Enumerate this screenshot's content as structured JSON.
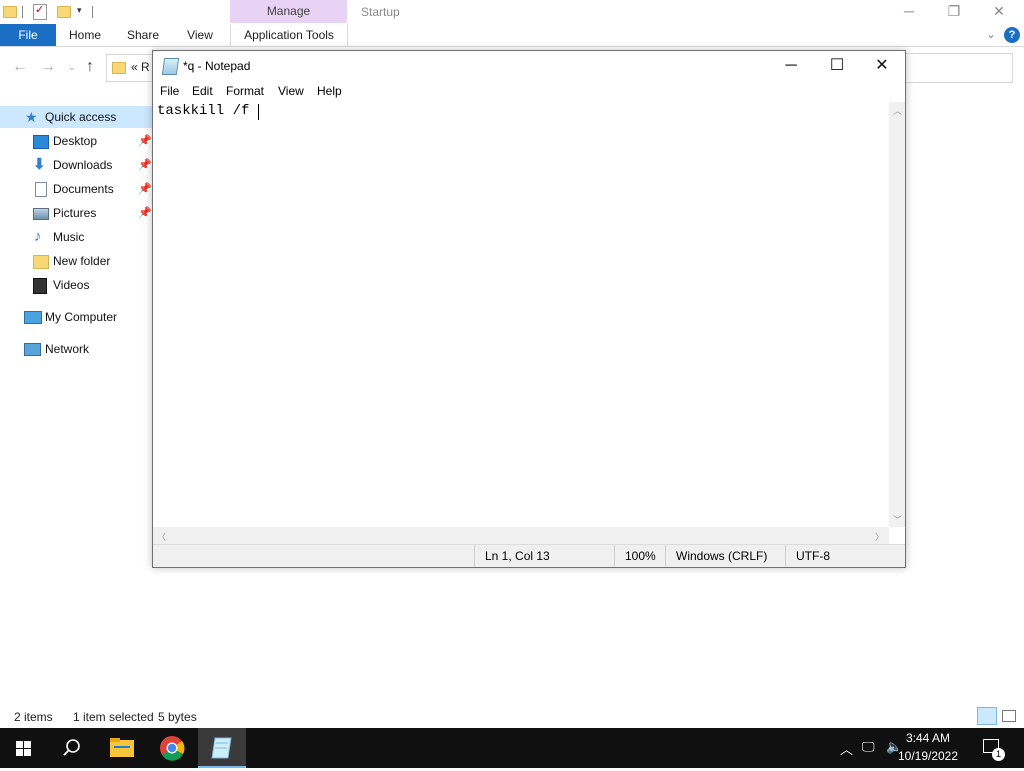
{
  "explorer": {
    "context_tab": "Manage",
    "window_title": "Startup",
    "ribbon_tabs": [
      "File",
      "Home",
      "Share",
      "View",
      "Application Tools"
    ],
    "address_prefix": "« R",
    "nav": {
      "quick_access": "Quick access",
      "items": [
        {
          "label": "Desktop",
          "pinned": true
        },
        {
          "label": "Downloads",
          "pinned": true
        },
        {
          "label": "Documents",
          "pinned": true
        },
        {
          "label": "Pictures",
          "pinned": true
        },
        {
          "label": "Music",
          "pinned": false
        },
        {
          "label": "New folder",
          "pinned": false
        },
        {
          "label": "Videos",
          "pinned": false
        }
      ],
      "my_computer": "My Computer",
      "network": "Network"
    },
    "status": {
      "items": "2 items",
      "selected": "1 item selected",
      "size": "5 bytes"
    },
    "icons": {
      "pin": "pin-icon",
      "help": "help-icon"
    }
  },
  "notepad": {
    "title": "*q - Notepad",
    "menu": [
      "File",
      "Edit",
      "Format",
      "View",
      "Help"
    ],
    "content": "taskkill /f ",
    "status": {
      "position": "Ln 1, Col 13",
      "zoom": "100%",
      "line_ending": "Windows (CRLF)",
      "encoding": "UTF-8"
    }
  },
  "taskbar": {
    "time": "3:44 AM",
    "date": "10/19/2022",
    "notification_count": "1"
  },
  "colors": {
    "file_tab": "#1a6fc4",
    "context_tab": "#e9d3f4",
    "selection": "#cce8ff",
    "taskbar": "#101010"
  }
}
